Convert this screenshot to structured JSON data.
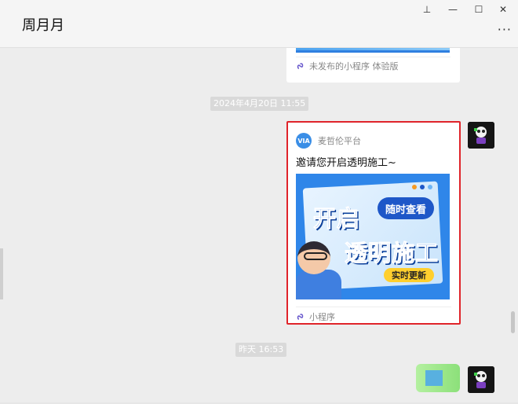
{
  "window": {
    "title": "周月月",
    "controls": {
      "pin": "⊥",
      "minimize": "—",
      "maximize": "☐",
      "close": "✕"
    },
    "more": "···"
  },
  "messages": [
    {
      "type": "miniprogram-card-partial",
      "footer_label": "未发布的小程序 体验版"
    },
    {
      "type": "timestamp",
      "text": "2024年4月20日 11:55"
    },
    {
      "type": "miniprogram-card",
      "app_name": "麦哲伦平台",
      "app_logo_text": "VIA",
      "title": "邀请您开启透明施工~",
      "banner": {
        "line1": "开启",
        "line2": "透明施工",
        "bubble": "随时查看",
        "tag": "实时更新",
        "dot_colors": [
          "#f59a23",
          "#1e57c8",
          "#6fb5f5"
        ]
      },
      "footer_label": "小程序",
      "highlight_color": "#e0242a"
    },
    {
      "type": "timestamp",
      "text": "昨天 16:53"
    }
  ]
}
